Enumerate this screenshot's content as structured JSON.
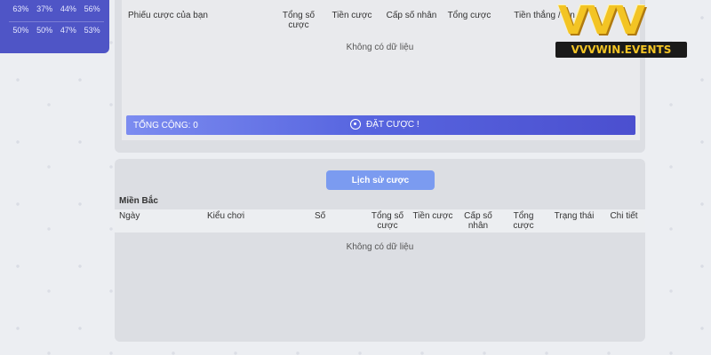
{
  "stats": {
    "row1": [
      "63%",
      "37%",
      "44%",
      "56%"
    ],
    "row2": [
      "50%",
      "50%",
      "47%",
      "53%"
    ]
  },
  "ticket": {
    "headers": {
      "ticket": "Phiếu cược của bạn",
      "total_bets": "Tổng số cược",
      "bet_money": "Tiền cược",
      "multiplier": "Cấp số nhân",
      "total_bet": "Tổng cược",
      "win_money": "Tiền thắng / lần"
    },
    "empty": "Không có dữ liệu",
    "total_label": "TỔNG CỘNG: 0",
    "bet_button": "ĐẶT CƯỢC !"
  },
  "history": {
    "button": "Lịch sử cược",
    "region": "Miền Bắc",
    "headers": {
      "date": "Ngày",
      "play_type": "Kiểu chơi",
      "number": "Số",
      "total_bets": "Tổng số cược",
      "bet_money": "Tiền cược",
      "multiplier": "Cấp số nhân",
      "total_bet": "Tổng cược",
      "status": "Trạng thái",
      "detail": "Chi tiết"
    },
    "empty": "Không có dữ liệu"
  },
  "logo": {
    "mark": "VVV",
    "text": "VVVWIN.EVENTS"
  },
  "colors": {
    "accent": "#4f55c6",
    "button": "#7b9bf0",
    "gold": "#f3c424"
  }
}
